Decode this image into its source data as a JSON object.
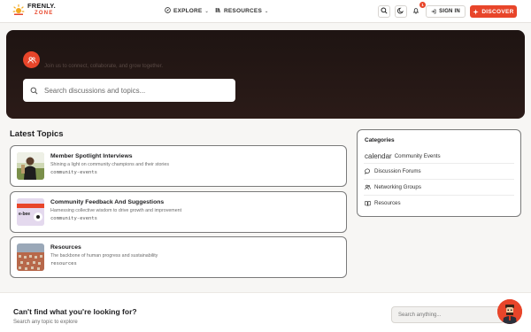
{
  "header": {
    "logo_top": "FRENLY.",
    "logo_bottom": "ZONE",
    "nav": [
      {
        "label": "EXPLORE",
        "icon": "compass-icon"
      },
      {
        "label": "RESOURCES",
        "icon": "library-icon"
      }
    ],
    "notification_count": "1",
    "signin_label": "SIGN IN",
    "discover_label": "DISCOVER"
  },
  "hero": {
    "subtitle": "Join us to connect, collaborate, and grow together.",
    "search_placeholder": "Search discussions and topics..."
  },
  "latest_topics": {
    "title": "Latest Topics",
    "items": [
      {
        "title": "Member Spotlight Interviews",
        "description": "Shining a light on community champions and their stories",
        "tag": "community-events"
      },
      {
        "title": "Community Feedback And Suggestions",
        "description": "Harnessing collective wisdom to drive growth and improvement",
        "tag": "community-events",
        "thumb_text": "e-bee"
      },
      {
        "title": "Resources",
        "description": "The backbone of human progress and sustainability",
        "tag": "resources"
      }
    ]
  },
  "categories": {
    "title": "Categories",
    "items": [
      {
        "label": "Community Events",
        "icon_word": "calendar",
        "icon": "calendar-icon"
      },
      {
        "label": "Discussion Forums",
        "icon": "chat-icon"
      },
      {
        "label": "Networking Groups",
        "icon": "users-icon"
      },
      {
        "label": "Resources",
        "icon": "book-icon"
      }
    ]
  },
  "footer": {
    "title": "Can't find what you're looking for?",
    "subtitle": "Search any topic to explore",
    "search_placeholder": "Search anything..."
  },
  "colors": {
    "accent": "#e8452a",
    "hero_bg": "#2b1b18",
    "page_bg": "#f7f6f4"
  }
}
